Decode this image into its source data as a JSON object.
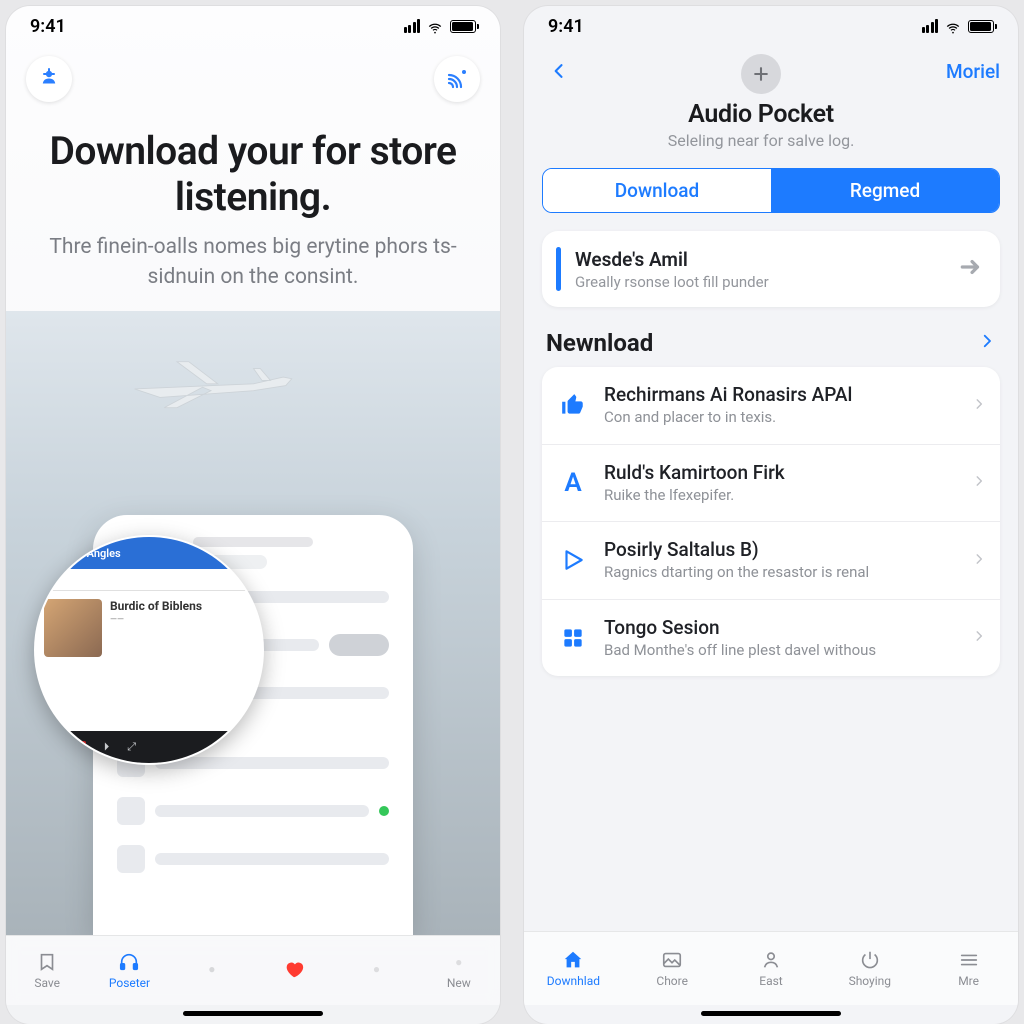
{
  "status": {
    "time": "9:41"
  },
  "left": {
    "headline": "Download your for store listening.",
    "subtext": "Thre finein-oalls nomes big erytine phors ts-sidnuin on the consint.",
    "zoom": {
      "header": "Blind of Angles",
      "title": "Burdic of Biblens",
      "tag": "Burnone"
    },
    "tabs": [
      {
        "label": "Save",
        "icon": "bookmark"
      },
      {
        "label": "Poseter",
        "icon": "headphones"
      },
      {
        "label": "",
        "icon": "blank"
      },
      {
        "label": "",
        "icon": "heart"
      },
      {
        "label": "",
        "icon": "blank"
      },
      {
        "label": "New",
        "icon": "blank"
      }
    ]
  },
  "right": {
    "nav_action": "Moriel",
    "title": "Audio Pocket",
    "subtitle": "Seleling near for salve log.",
    "segments": {
      "a": "Download",
      "b": "Regmed"
    },
    "featured": {
      "title": "Wesde's Amil",
      "subtitle": "Greally rsonse loot fill punder"
    },
    "section": "Newnload",
    "items": [
      {
        "title": "Rechirmans Ai Ronasirs APAl",
        "subtitle": "Con and placer to in texis.",
        "icon": "thumb"
      },
      {
        "title": "Ruld's Kamirtoon Firk",
        "subtitle": "Ruike the lfexepifer.",
        "icon": "letter"
      },
      {
        "title": "Posirly Saltalus B)",
        "subtitle": "Ragnics dtarting on the resastor is renal",
        "icon": "play"
      },
      {
        "title": "Tongo Sesion",
        "subtitle": "Bad Monthe's off line plest davel withous",
        "icon": "grid"
      }
    ],
    "tabs": [
      {
        "label": "Downhlad",
        "icon": "home",
        "active": true
      },
      {
        "label": "Chore",
        "icon": "image"
      },
      {
        "label": "East",
        "icon": "person"
      },
      {
        "label": "Shoying",
        "icon": "power"
      },
      {
        "label": "Mre",
        "icon": "menu"
      }
    ]
  }
}
